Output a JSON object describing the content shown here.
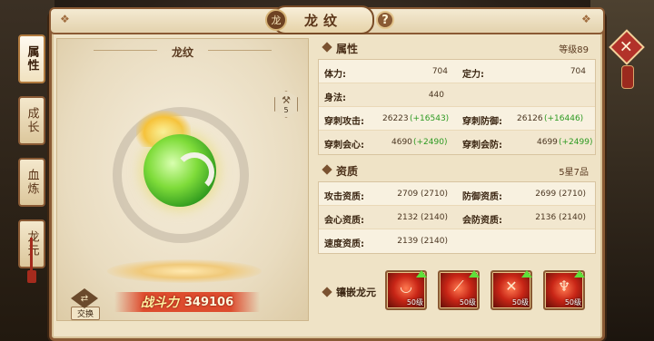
{
  "window": {
    "title": "龙纹",
    "emblem": "龙",
    "help": "?",
    "close": "✕"
  },
  "tabs": [
    {
      "label": "属性",
      "active": true
    },
    {
      "label": "成长",
      "active": false
    },
    {
      "label": "血炼",
      "active": false
    },
    {
      "label": "龙元",
      "active": false
    }
  ],
  "left": {
    "title": "龙纹",
    "level_badge": "5",
    "swap_label": "交换",
    "power_label": "战斗力",
    "power_value": "349106"
  },
  "attributes": {
    "title": "属性",
    "grade": "等级89",
    "rows": [
      {
        "l1": "体力:",
        "v1": "704",
        "l2": "定力:",
        "v2": "704"
      },
      {
        "l1": "身法:",
        "v1": "440"
      },
      {
        "l1": "穿刺攻击:",
        "v1": "26223",
        "b1": "(+16543)",
        "l2": "穿刺防御:",
        "v2": "26126",
        "b2": "(+16446)"
      },
      {
        "l1": "穿刺会心:",
        "v1": "4690",
        "b1": "(+2490)",
        "l2": "穿刺会防:",
        "v2": "4699",
        "b2": "(+2499)"
      }
    ]
  },
  "quality": {
    "title": "资质",
    "grade": "5星7品",
    "rows": [
      {
        "l1": "攻击资质:",
        "v1": "2709 (2710)",
        "l2": "防御资质:",
        "v2": "2699 (2710)"
      },
      {
        "l1": "会心资质:",
        "v1": "2132 (2140)",
        "l2": "会防资质:",
        "v2": "2136 (2140)"
      },
      {
        "l1": "速度资质:",
        "v1": "2139 (2140)"
      }
    ]
  },
  "gems": {
    "title": "镶嵌龙元",
    "items": [
      {
        "level": "50级",
        "icon": "fire-bowl-icon"
      },
      {
        "level": "50级",
        "icon": "fire-claw-icon"
      },
      {
        "level": "50级",
        "icon": "fire-cross-icon"
      },
      {
        "level": "50级",
        "icon": "fire-warrior-icon"
      }
    ]
  },
  "colors": {
    "frame": "#8a5a34",
    "panel": "#efe3c6",
    "bonus": "#2d9a22",
    "gem": "#c82516"
  }
}
